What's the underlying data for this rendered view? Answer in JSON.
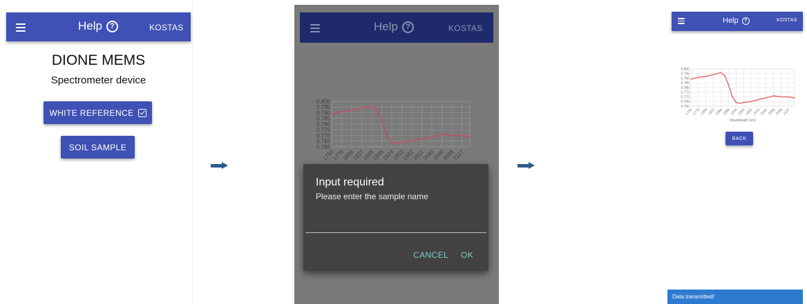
{
  "colors": {
    "primary": "#3f51b5",
    "arrow": "#2e5a8c",
    "chart_line": "#e57373",
    "toast": "#2c7bd1",
    "dialog_accent": "#80cbc4"
  },
  "screen1": {
    "appbar": {
      "menu_icon": "hamburger-menu-icon",
      "title": "Help",
      "help_icon": "help-circle-icon",
      "user": "KOSTAS"
    },
    "title": "DIONE MEMS",
    "subtitle": "Spectrometer device",
    "white_reference_label": "WHITE REFERENCE",
    "white_reference_checked": true,
    "soil_sample_label": "SOIL SAMPLE"
  },
  "screen2": {
    "appbar": {
      "title": "Help",
      "user": "KOSTAS"
    },
    "dialog": {
      "title": "Input required",
      "message": "Please enter the sample name",
      "input_value": "",
      "cancel_label": "CANCEL",
      "ok_label": "OK"
    }
  },
  "screen3": {
    "appbar": {
      "title": "Help",
      "user": "KOSTAS"
    },
    "back_label": "BACK",
    "toast": "Data transmitted!"
  },
  "chart_data": {
    "type": "line",
    "xlabel": "Wavelength (nm)",
    "ylim": [
      0.76,
      0.8
    ],
    "yticks": [
      0.8,
      0.795,
      0.79,
      0.785,
      0.78,
      0.775,
      0.77,
      0.765,
      0.76
    ],
    "xticks": [
      1750,
      1779,
      1808,
      1837,
      1866,
      1895,
      1924,
      1953,
      1982,
      2011,
      2040,
      2069,
      2098,
      2127
    ],
    "x": [
      1750,
      1779,
      1808,
      1837,
      1866,
      1880,
      1895,
      1910,
      1924,
      1939,
      1953,
      1982,
      2011,
      2040,
      2069,
      2098,
      2127,
      2150
    ],
    "y": [
      0.789,
      0.791,
      0.792,
      0.794,
      0.796,
      0.793,
      0.783,
      0.77,
      0.764,
      0.763,
      0.764,
      0.765,
      0.767,
      0.769,
      0.771,
      0.77,
      0.77,
      0.769
    ]
  }
}
